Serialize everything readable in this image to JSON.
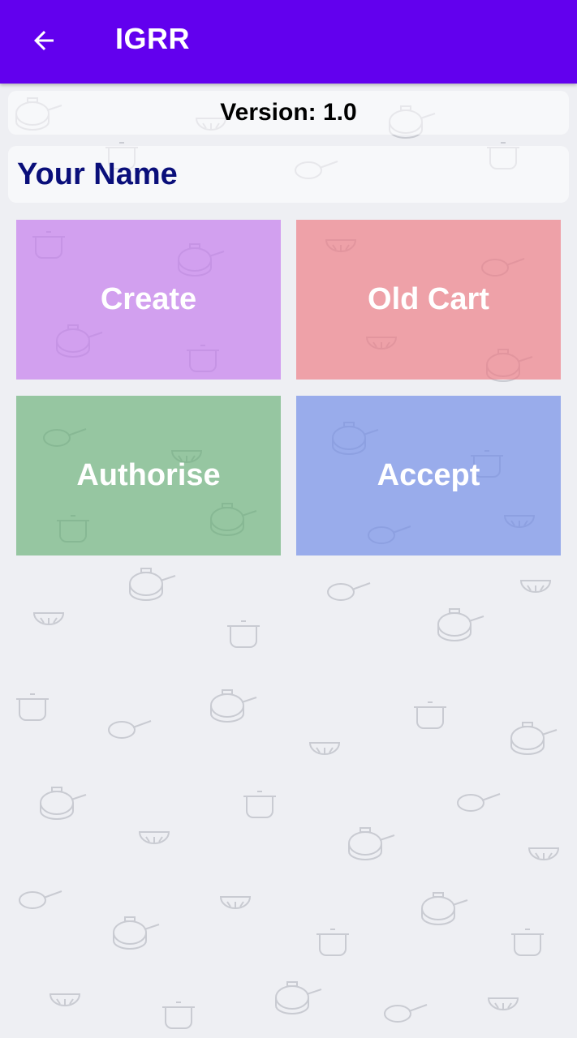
{
  "app_bar": {
    "title": "IGRR",
    "back_icon": "arrow-left-icon",
    "color": "#6200ee"
  },
  "version": {
    "text": "Version: 1.0"
  },
  "user": {
    "name": "Your Name"
  },
  "tiles": [
    {
      "label": "Create",
      "color": "#c47aee"
    },
    {
      "label": "Old Cart",
      "color": "#ee7c84"
    },
    {
      "label": "Authorise",
      "color": "#60ac6e"
    },
    {
      "label": "Accept",
      "color": "#708ce8"
    }
  ]
}
